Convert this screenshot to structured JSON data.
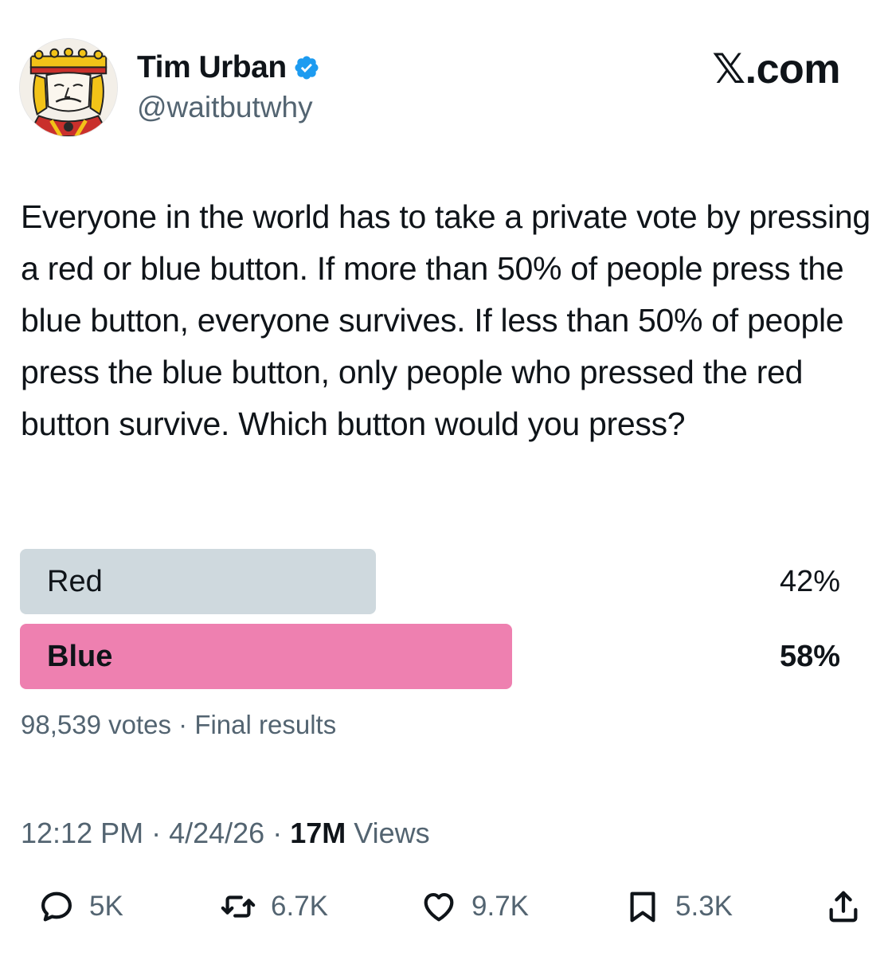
{
  "author": {
    "display_name": "Tim Urban",
    "handle": "@waitbutwhy",
    "verified_color": "#1d9bf0"
  },
  "brand": "𝕏.com",
  "tweet": {
    "text": "Everyone in the world has to take a private vote by pressing a red or blue button. If more than 50% of people press the blue button, everyone survives. If less than 50% of people press the blue button, only people who pressed the red button survive. Which button would you press?"
  },
  "poll": {
    "options": [
      {
        "label": "Red",
        "percent_text": "42%",
        "percent": 42,
        "color": "#cfd9de",
        "winner": false
      },
      {
        "label": "Blue",
        "percent_text": "58%",
        "percent": 58,
        "color": "#ee80b0",
        "winner": true
      }
    ],
    "votes": "98,539 votes",
    "separator": " · ",
    "status": "Final results"
  },
  "meta": {
    "time": "12:12 PM",
    "date": "4/24/26",
    "views_count": "17M",
    "views_label": "Views",
    "separator": " · "
  },
  "actions": {
    "reply": {
      "icon": "reply-icon",
      "count": "5K"
    },
    "retweet": {
      "icon": "retweet-icon",
      "count": "6.7K"
    },
    "like": {
      "icon": "heart-icon",
      "count": "9.7K"
    },
    "bookmark": {
      "icon": "bookmark-icon",
      "count": "5.3K"
    },
    "share": {
      "icon": "share-icon"
    }
  }
}
